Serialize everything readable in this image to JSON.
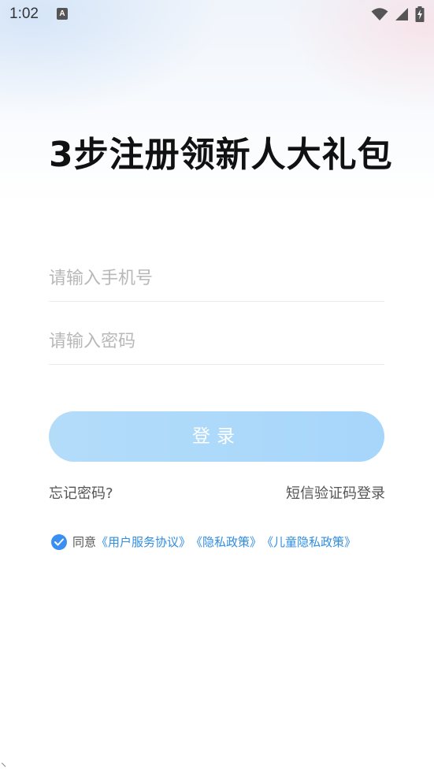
{
  "status_bar": {
    "time": "1:02",
    "notification_icon_label": "A",
    "icons": [
      "wifi-icon",
      "signal-icon",
      "battery-charging-icon"
    ]
  },
  "headline": "3步注册领新人大礼包",
  "form": {
    "phone_placeholder": "请输入手机号",
    "password_placeholder": "请输入密码",
    "login_label": "登录"
  },
  "links": {
    "forgot_password": "忘记密码?",
    "sms_login": "短信验证码登录"
  },
  "agreement": {
    "checked": true,
    "prefix": "同意",
    "user_agreement": "《用户服务协议》",
    "privacy_policy": "《隐私政策》",
    "child_privacy_policy": "《儿童隐私政策》"
  },
  "colors": {
    "accent": "#3b8ff3",
    "link": "#2f8de4",
    "button_bg": "#a7d6fb"
  }
}
